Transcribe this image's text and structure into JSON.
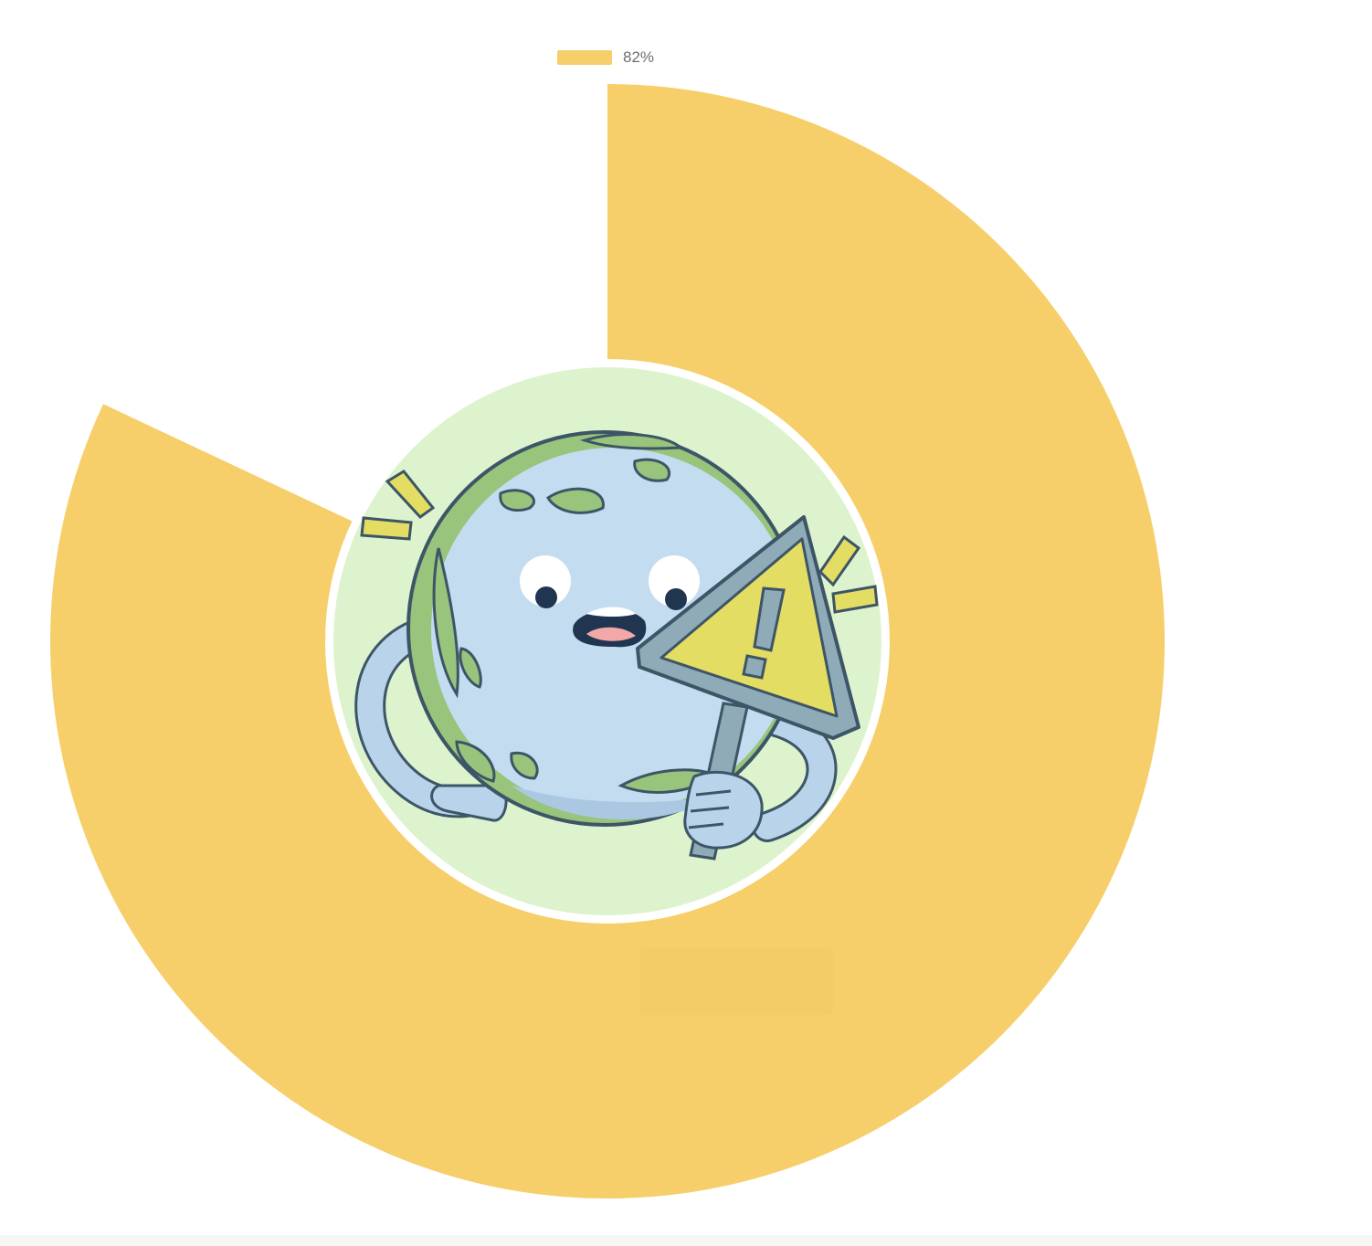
{
  "chart_data": {
    "type": "doughnut",
    "series": [
      {
        "name": "82%",
        "value": 82,
        "color": "#f6cf6b"
      }
    ],
    "max": 100,
    "start_angle_deg": 0,
    "legend_position": "top",
    "center_image": "earth-holding-warning-sign-icon"
  },
  "colors": {
    "ring": "#f6cf6b",
    "center_bg": "#dcf3cd",
    "earth_ocean": "#c4dcf0",
    "earth_land": "#98c47c",
    "outline": "#3d5566",
    "warning_sign": "#e4dd63",
    "sign_frame": "#8fabb8"
  }
}
